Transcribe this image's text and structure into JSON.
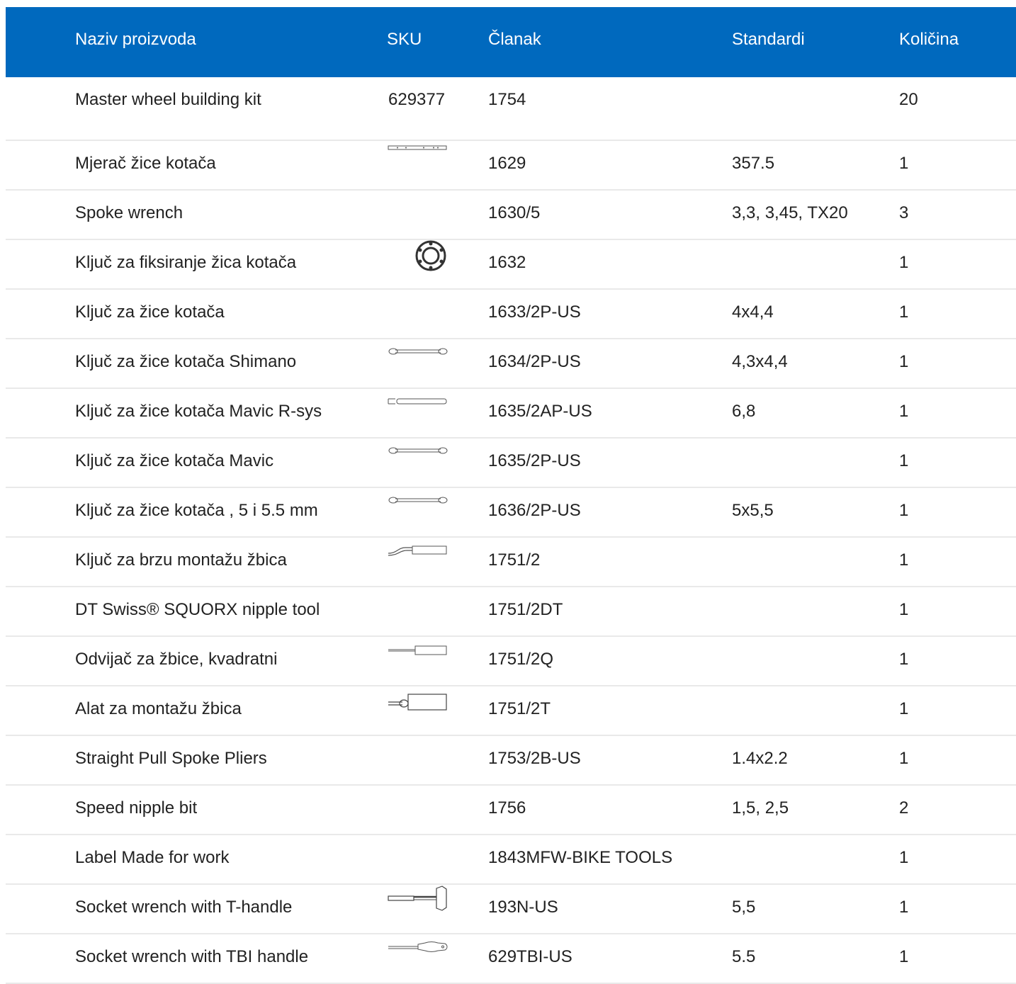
{
  "header": {
    "name": "Naziv proizvoda",
    "sku": "SKU",
    "article": "Članak",
    "standards": "Standardi",
    "qty": "Količina"
  },
  "rows": [
    {
      "name": "Master wheel building kit",
      "sku": "629377",
      "article": "1754",
      "standards": "",
      "qty": "20",
      "icon": "none"
    },
    {
      "name": "Mjerač žice kotača",
      "sku": "",
      "article": "1629",
      "standards": "357.5",
      "qty": "1",
      "icon": "spoke-gauge-icon"
    },
    {
      "name": "Spoke wrench",
      "sku": "",
      "article": "1630/5",
      "standards": "3,3, 3,45, TX20",
      "qty": "3",
      "icon": "none"
    },
    {
      "name": "Ključ za fiksiranje žica kotača",
      "sku": "",
      "article": "1632",
      "standards": "",
      "qty": "1",
      "icon": "ring-wrench-icon"
    },
    {
      "name": "Ključ za žice kotača",
      "sku": "",
      "article": "1633/2P-US",
      "standards": "4x4,4",
      "qty": "1",
      "icon": "none"
    },
    {
      "name": "Ključ za žice kotača Shimano",
      "sku": "",
      "article": "1634/2P-US",
      "standards": "4,3x4,4",
      "qty": "1",
      "icon": "double-wrench-icon"
    },
    {
      "name": "Ključ za žice kotača Mavic R-sys",
      "sku": "",
      "article": "1635/2AP-US",
      "standards": "6,8",
      "qty": "1",
      "icon": "flat-wrench-icon"
    },
    {
      "name": "Ključ za žice kotača Mavic",
      "sku": "",
      "article": "1635/2P-US",
      "standards": "",
      "qty": "1",
      "icon": "double-wrench-icon"
    },
    {
      "name": "Ključ za žice kotača , 5 i 5.5 mm",
      "sku": "",
      "article": "1636/2P-US",
      "standards": "5x5,5",
      "qty": "1",
      "icon": "double-wrench-icon"
    },
    {
      "name": "Ključ za brzu montažu žbica",
      "sku": "",
      "article": "1751/2",
      "standards": "",
      "qty": "1",
      "icon": "crank-driver-icon"
    },
    {
      "name": "DT Swiss® SQUORX nipple tool",
      "sku": "",
      "article": "1751/2DT",
      "standards": "",
      "qty": "1",
      "icon": "none"
    },
    {
      "name": "Odvijač za žbice, kvadratni",
      "sku": "",
      "article": "1751/2Q",
      "standards": "",
      "qty": "1",
      "icon": "screwdriver-icon"
    },
    {
      "name": "Alat za montažu žbica",
      "sku": "",
      "article": "1751/2T",
      "standards": "",
      "qty": "1",
      "icon": "nipple-driver-icon"
    },
    {
      "name": "Straight Pull Spoke Pliers",
      "sku": "",
      "article": "1753/2B-US",
      "standards": "1.4x2.2",
      "qty": "1",
      "icon": "none"
    },
    {
      "name": "Speed nipple bit",
      "sku": "",
      "article": "1756",
      "standards": "1,5, 2,5",
      "qty": "2",
      "icon": "none"
    },
    {
      "name": "Label Made for work",
      "sku": "",
      "article": "1843MFW-BIKE TOOLS",
      "standards": "",
      "qty": "1",
      "icon": "none"
    },
    {
      "name": "Socket wrench with T-handle",
      "sku": "",
      "article": "193N-US",
      "standards": "5,5",
      "qty": "1",
      "icon": "t-handle-wrench-icon"
    },
    {
      "name": "Socket wrench with TBI handle",
      "sku": "",
      "article": "629TBI-US",
      "standards": "5.5",
      "qty": "1",
      "icon": "tbi-handle-wrench-icon"
    }
  ]
}
